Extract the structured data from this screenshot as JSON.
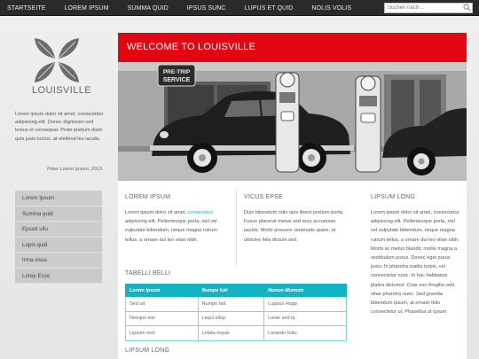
{
  "nav": {
    "items": [
      "Startseite",
      "Lorem ipsum",
      "Summa quid",
      "Ipsus sunc",
      "Lupus et quid",
      "Nolis volis"
    ],
    "search_placeholder": "Suchen nach ..."
  },
  "sidebar": {
    "brand": "LOUISVILLE",
    "text": "Lorem ipsum dolor sit amet, consectetur adipiscing elit. Donec dignissim sed lectus et consequat. Proin pretium diam quis justo luctus, at eleifend leo iaculis.",
    "signature": "Peter Lorem Ipsum, 2013",
    "menu": [
      "Lorem Ipsum",
      "Summa quid",
      "Epsod ullu",
      "Lopis quid",
      "Irma visus",
      "Lorep Ecce"
    ]
  },
  "header": {
    "title": "WELCOME TO LOUISVILLE",
    "hero_signs": [
      "PRE-TRIP",
      "SERVICE"
    ]
  },
  "columns": {
    "col1": {
      "heading": "LOREM IPSUM",
      "text_before_link": "Lorem ipsum dolor sit amet, ",
      "link": "consectetur",
      "text_after_link": " adipiscing elit. Pellentesque porta, nisl vel vulputate bibendum, neque magna rutrum tellus, a ornare dui leo vitae nibh."
    },
    "col2": {
      "heading": "VICUS EPSE",
      "text": "Duis bibendum odio quis libero pretium porta. Fusce placerat metus sed arcu accumsan iaculis. Morbi posuere venenatis quam, at ultricies felis dictum sed."
    },
    "col3": {
      "heading": "LIPSUM LONG",
      "text": "Lorem ipsum dolor sit amet, consectetur adipiscing elit. Pellentesque porta, nisl vel vulputate bibendum, neque magna rutrum tellus, a ornare dui leo vitae nibh. Morbi ac metus blandit, mollis magna a, vestibulum purus. Donec eget purus justo. In pharetra mattis turpis, vel consectetur nunc. In hac habitasse platea dictumst. Cras non fringilla velit, vitae pharetra nunc. Sed gravida bibendum ipsum, at ornare felis consectetur ut. Phasellus ut ipsum"
    }
  },
  "table": {
    "heading": "TABELLI BELLI",
    "headers": [
      "Lorem Ipsum",
      "Numpe futt",
      "Nunun Mumum"
    ],
    "rows": [
      [
        "Sed ud",
        "Numpe fatt",
        "Luppus Hupp"
      ],
      [
        "Nenquo issi",
        "Lequi ollop",
        "Loran sed iq"
      ],
      [
        "Lipsum orot",
        "Letata inquis",
        "Lorando futtu"
      ]
    ]
  },
  "bottom_heading": "LIPSUM LONG",
  "colors": {
    "accent_red": "#e30613",
    "table_teal": "#14b3c3",
    "link_blue": "#25a9c9",
    "nav_bg": "#2a2a2a"
  }
}
